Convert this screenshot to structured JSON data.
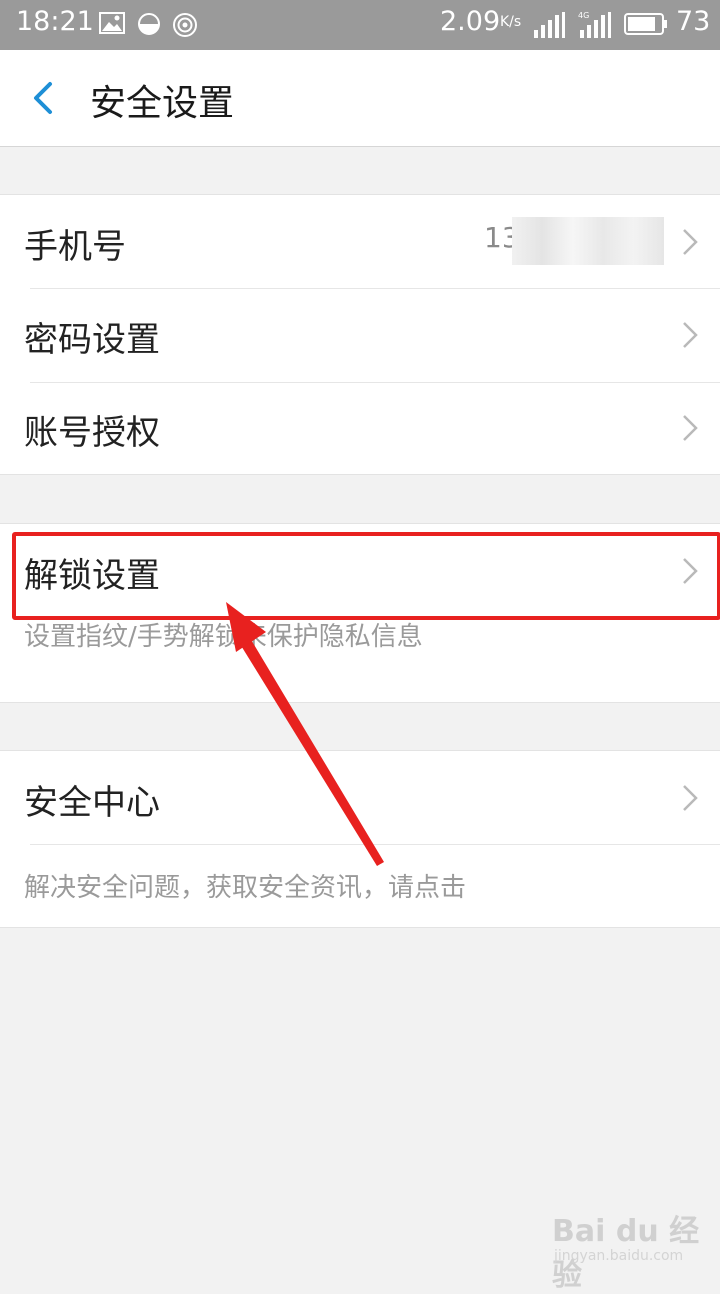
{
  "status_bar": {
    "time": "18:21",
    "net_speed": "2.09",
    "net_speed_unit": "K/s",
    "battery": "73",
    "icons": [
      "image-icon",
      "half-moon-icon",
      "hotspot-icon",
      "signal-icon",
      "signal-4g-icon",
      "battery-icon"
    ]
  },
  "header": {
    "title": "安全设置",
    "back_icon": "chevron-left-icon"
  },
  "account_group": {
    "items": [
      {
        "label": "手机号",
        "value": "13"
      },
      {
        "label": "密码设置"
      },
      {
        "label": "账号授权"
      }
    ]
  },
  "unlock_group": {
    "label": "解锁设置",
    "description": "设置指纹/手势解锁来保护隐私信息"
  },
  "security_group": {
    "label": "安全中心",
    "description": "解决安全问题，获取安全资讯，请点击"
  },
  "watermark": {
    "brand": "Bai du 经验",
    "url": "jingyan.baidu.com"
  },
  "colors": {
    "accent_blue": "#1e8fd6",
    "annotation_red": "#e8211f",
    "status_bar_bg": "#9a9a9a",
    "page_bg": "#f2f2f2"
  }
}
